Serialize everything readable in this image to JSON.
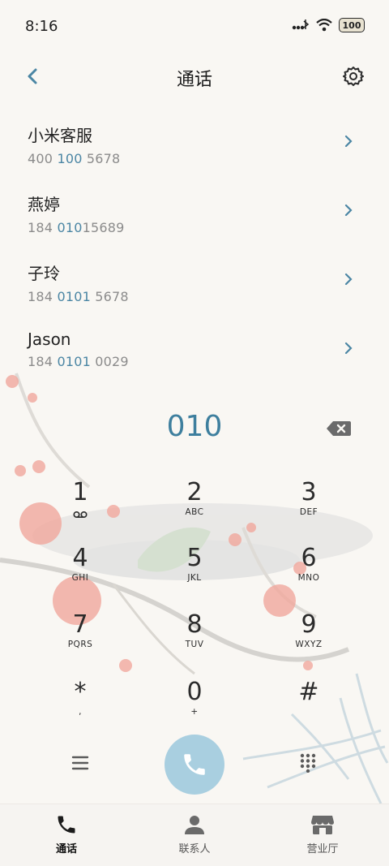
{
  "status": {
    "time": "8:16",
    "battery": "100"
  },
  "header": {
    "title": "通话"
  },
  "contacts": [
    {
      "name": "小米客服",
      "num_a": "400 ",
      "num_hl": "100",
      "num_b": " 5678"
    },
    {
      "name": "燕婷",
      "num_a": "184 ",
      "num_hl": "010",
      "num_b": "15689"
    },
    {
      "name": "子玲",
      "num_a": "184 ",
      "num_hl": "0101",
      "num_b": " 5678"
    },
    {
      "name": "Jason",
      "num_a": "184 ",
      "num_hl": "0101",
      "num_b": " 0029"
    }
  ],
  "dial": {
    "digits": "010"
  },
  "keypad": [
    {
      "digit": "1",
      "letters": ""
    },
    {
      "digit": "2",
      "letters": "ABC"
    },
    {
      "digit": "3",
      "letters": "DEF"
    },
    {
      "digit": "4",
      "letters": "GHI"
    },
    {
      "digit": "5",
      "letters": "JKL"
    },
    {
      "digit": "6",
      "letters": "MNO"
    },
    {
      "digit": "7",
      "letters": "PQRS"
    },
    {
      "digit": "8",
      "letters": "TUV"
    },
    {
      "digit": "9",
      "letters": "WXYZ"
    },
    {
      "digit": "*",
      "letters": ","
    },
    {
      "digit": "0",
      "letters": "+"
    },
    {
      "digit": "#",
      "letters": ""
    }
  ],
  "nav": {
    "calls": "通话",
    "contacts": "联系人",
    "hall": "营业厅"
  },
  "colors": {
    "accent": "#3e7f9e",
    "call_button": "#a9cfe0",
    "background": "#f9f7f3"
  },
  "icons": [
    "back-arrow-icon",
    "settings-gear-icon",
    "chevron-right-icon",
    "backspace-icon",
    "voicemail-icon",
    "menu-icon",
    "call-icon",
    "dialpad-icon",
    "phone-tab-icon",
    "person-tab-icon",
    "store-tab-icon"
  ]
}
